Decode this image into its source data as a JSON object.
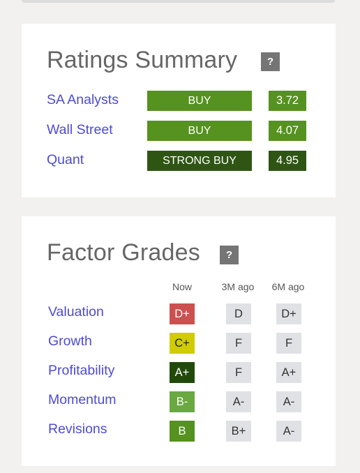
{
  "ratings_summary": {
    "title": "Ratings Summary",
    "help_label": "?",
    "rows": [
      {
        "label": "SA Analysts",
        "rating": "BUY",
        "score": "3.72",
        "color": "#55921f"
      },
      {
        "label": "Wall Street",
        "rating": "BUY",
        "score": "4.07",
        "color": "#55921f"
      },
      {
        "label": "Quant",
        "rating": "STRONG BUY",
        "score": "4.95",
        "color": "#2f5514"
      }
    ]
  },
  "factor_grades": {
    "title": "Factor Grades",
    "help_label": "?",
    "columns": [
      "Now",
      "3M ago",
      "6M ago"
    ],
    "rows": [
      {
        "label": "Valuation",
        "now": "D+",
        "now_color": "#cc5050",
        "now_text_color": "#ffffff",
        "m3": "D",
        "m6": "D+"
      },
      {
        "label": "Growth",
        "now": "C+",
        "now_color": "#d0cc00",
        "now_text_color": "#222222",
        "m3": "F",
        "m6": "F"
      },
      {
        "label": "Profitability",
        "now": "A+",
        "now_color": "#214a0a",
        "now_text_color": "#ffffff",
        "m3": "F",
        "m6": "A+"
      },
      {
        "label": "Momentum",
        "now": "B-",
        "now_color": "#6aa842",
        "now_text_color": "#ffffff",
        "m3": "A-",
        "m6": "A-"
      },
      {
        "label": "Revisions",
        "now": "B",
        "now_color": "#55921f",
        "now_text_color": "#ffffff",
        "m3": "B+",
        "m6": "A-"
      }
    ]
  }
}
